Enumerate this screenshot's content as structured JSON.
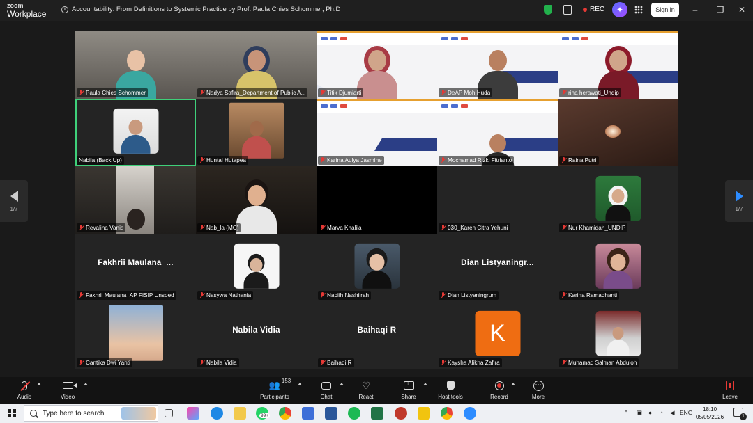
{
  "app": {
    "brand_top": "zoom",
    "brand_bottom": "Workplace",
    "meeting_title": "Accountability: From Definitions to Systemic Practice by Prof. Paula Chies Schommer, Ph.D",
    "rec_label": "REC",
    "signin_label": "Sign in",
    "info_icon": "info-icon"
  },
  "gallery": {
    "page_indicator_left": "1/7",
    "page_indicator_right": "1/7",
    "tiles": [
      {
        "name": "Paula Chies Schommer"
      },
      {
        "name": "Nadya Safira_Department of Public A..."
      },
      {
        "name": "Titik Djumiarti"
      },
      {
        "name": "DeAP Moh Huda"
      },
      {
        "name": "rina herawati_Undip"
      },
      {
        "name": "Nabila (Back Up)"
      },
      {
        "name": "Huntal Hutapea"
      },
      {
        "name": "Karina Aulya Jasmine"
      },
      {
        "name": "Mochamad Rizki Fitrianto"
      },
      {
        "name": "Raina Putri"
      },
      {
        "name": "Revalina Vania"
      },
      {
        "name": "Nab_la (MC)"
      },
      {
        "name": "Marva Khalila"
      },
      {
        "name": "030_Karen Citra Yehuni"
      },
      {
        "name": "Nur Khamidah_UNDIP"
      },
      {
        "name": "Fakhrii Maulana_AP FISIP Unsoed",
        "big": "Fakhrii  Maulana_..."
      },
      {
        "name": "Nasywa Nathania"
      },
      {
        "name": "Nabiih Nashiirah"
      },
      {
        "name": "Dian Listyaningrum",
        "big": "Dian  Listyaningr..."
      },
      {
        "name": "Karina Ramadhanti"
      },
      {
        "name": "Cantika Dwi Yanti"
      },
      {
        "name": "Nabila Vidia",
        "big": "Nabila Vidia"
      },
      {
        "name": "Baihaqi R",
        "big": "Baihaqi R"
      },
      {
        "name": "Kaysha Alikha Zafira",
        "letter": "K"
      },
      {
        "name": "Muhamad Salman Abduloh"
      }
    ]
  },
  "toolbar": {
    "audio": "Audio",
    "video": "Video",
    "participants": "Participants",
    "participants_count": "153",
    "chat": "Chat",
    "react": "React",
    "share": "Share",
    "host_tools": "Host tools",
    "record": "Record",
    "more": "More",
    "leave": "Leave"
  },
  "taskbar": {
    "search_placeholder": "Type here to search",
    "lang": "ENG",
    "time": "18:10",
    "date": "05/05/2026",
    "notif_count": "1",
    "tray_badge": "99+"
  },
  "colors": {
    "active_speaker": "#3fd07a",
    "muted_red": "#e53935",
    "accent_blue": "#2d8cff",
    "letter_avatar": "#ef6d12"
  }
}
